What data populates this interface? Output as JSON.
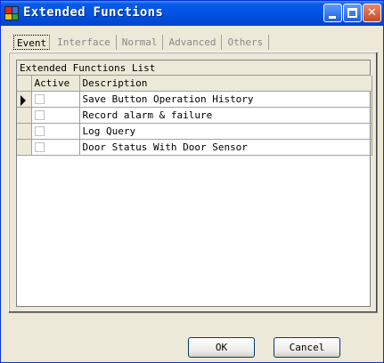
{
  "window": {
    "title": "Extended Functions"
  },
  "tabs": [
    {
      "label": "Event",
      "active": true
    },
    {
      "label": "Interface",
      "active": false
    },
    {
      "label": "Normal",
      "active": false
    },
    {
      "label": "Advanced",
      "active": false
    },
    {
      "label": "Others",
      "active": false
    }
  ],
  "grid": {
    "caption": "Extended Functions List",
    "columns": [
      "Active",
      "Description"
    ],
    "rows": [
      {
        "active": false,
        "description": "Save Button Operation History",
        "current": true
      },
      {
        "active": false,
        "description": "Record alarm & failure",
        "current": false
      },
      {
        "active": false,
        "description": "Log Query",
        "current": false
      },
      {
        "active": false,
        "description": "Door Status With Door Sensor",
        "current": false
      }
    ]
  },
  "buttons": {
    "ok_label": "OK",
    "cancel_label": "Cancel"
  },
  "colors": {
    "titlebar": "#0055e5",
    "window_bg": "#ece9d8"
  },
  "icons": {
    "app": "app-icon",
    "minimize": "minimize-icon",
    "maximize": "maximize-icon",
    "close": "close-icon",
    "row_pointer": "row-pointer-icon"
  }
}
